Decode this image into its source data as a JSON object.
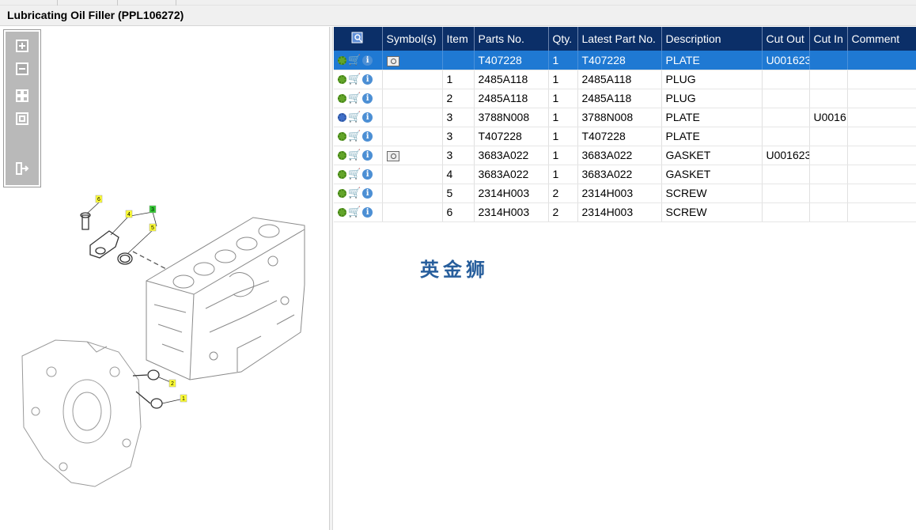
{
  "window": {
    "title": "Lubricating Oil Filler (PPL106272)"
  },
  "toolbox": {
    "buttons": [
      {
        "name": "zoom-in-icon"
      },
      {
        "name": "zoom-out-icon"
      },
      {
        "name": "fit-all-icon"
      },
      {
        "name": "actual-size-icon"
      },
      {
        "name": "export-icon"
      }
    ]
  },
  "diagram": {
    "callouts": [
      "6",
      "4",
      "3",
      "5",
      "2",
      "1"
    ]
  },
  "grid": {
    "columns": [
      "Symbol(s)",
      "Item",
      "Parts No.",
      "Qty.",
      "Latest Part No.",
      "Description",
      "Cut Out",
      "Cut In",
      "Comment"
    ],
    "rows": [
      {
        "selected": true,
        "gear": "green",
        "symbol": true,
        "item": "",
        "part": "T407228",
        "qty": "1",
        "latest": "T407228",
        "desc": "PLATE",
        "cut_out": "U001623",
        "cut_in": "",
        "comment": ""
      },
      {
        "selected": false,
        "gear": "green",
        "symbol": false,
        "item": "1",
        "part": "2485A118",
        "qty": "1",
        "latest": "2485A118",
        "desc": "PLUG",
        "cut_out": "",
        "cut_in": "",
        "comment": ""
      },
      {
        "selected": false,
        "gear": "green",
        "symbol": false,
        "item": "2",
        "part": "2485A118",
        "qty": "1",
        "latest": "2485A118",
        "desc": "PLUG",
        "cut_out": "",
        "cut_in": "",
        "comment": ""
      },
      {
        "selected": false,
        "gear": "blue",
        "symbol": false,
        "item": "3",
        "part": "3788N008",
        "qty": "1",
        "latest": "3788N008",
        "desc": "PLATE",
        "cut_out": "",
        "cut_in": "U0016",
        "comment": ""
      },
      {
        "selected": false,
        "gear": "green",
        "symbol": false,
        "item": "3",
        "part": "T407228",
        "qty": "1",
        "latest": "T407228",
        "desc": "PLATE",
        "cut_out": "",
        "cut_in": "",
        "comment": ""
      },
      {
        "selected": false,
        "gear": "green",
        "symbol": true,
        "item": "3",
        "part": "3683A022",
        "qty": "1",
        "latest": "3683A022",
        "desc": "GASKET",
        "cut_out": "U001623",
        "cut_in": "",
        "comment": ""
      },
      {
        "selected": false,
        "gear": "green",
        "symbol": false,
        "item": "4",
        "part": "3683A022",
        "qty": "1",
        "latest": "3683A022",
        "desc": "GASKET",
        "cut_out": "",
        "cut_in": "",
        "comment": ""
      },
      {
        "selected": false,
        "gear": "green",
        "symbol": false,
        "item": "5",
        "part": "2314H003",
        "qty": "2",
        "latest": "2314H003",
        "desc": "SCREW",
        "cut_out": "",
        "cut_in": "",
        "comment": ""
      },
      {
        "selected": false,
        "gear": "green",
        "symbol": false,
        "item": "6",
        "part": "2314H003",
        "qty": "2",
        "latest": "2314H003",
        "desc": "SCREW",
        "cut_out": "",
        "cut_in": "",
        "comment": ""
      }
    ]
  },
  "watermark": "英金狮",
  "colors": {
    "header": "#0b2f68",
    "selection": "#1f79d3",
    "callout": "#ffff33",
    "callout_selected": "#33cc33"
  }
}
